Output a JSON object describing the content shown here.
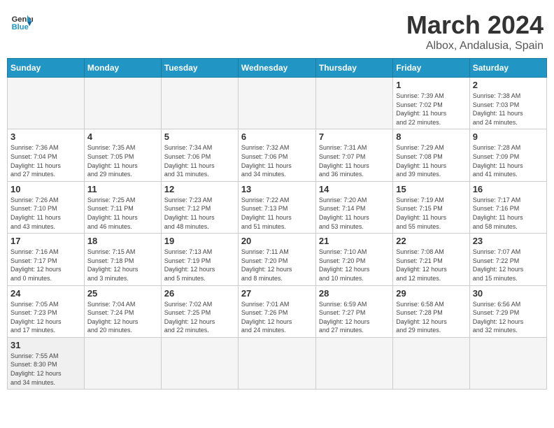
{
  "header": {
    "logo_text_black": "General",
    "logo_text_blue": "Blue",
    "main_title": "March 2024",
    "subtitle": "Albox, Andalusia, Spain"
  },
  "weekdays": [
    "Sunday",
    "Monday",
    "Tuesday",
    "Wednesday",
    "Thursday",
    "Friday",
    "Saturday"
  ],
  "weeks": [
    [
      {
        "day": "",
        "info": "",
        "empty": true
      },
      {
        "day": "",
        "info": "",
        "empty": true
      },
      {
        "day": "",
        "info": "",
        "empty": true
      },
      {
        "day": "",
        "info": "",
        "empty": true
      },
      {
        "day": "",
        "info": "",
        "empty": true
      },
      {
        "day": "1",
        "info": "Sunrise: 7:39 AM\nSunset: 7:02 PM\nDaylight: 11 hours\nand 22 minutes."
      },
      {
        "day": "2",
        "info": "Sunrise: 7:38 AM\nSunset: 7:03 PM\nDaylight: 11 hours\nand 24 minutes."
      }
    ],
    [
      {
        "day": "3",
        "info": "Sunrise: 7:36 AM\nSunset: 7:04 PM\nDaylight: 11 hours\nand 27 minutes."
      },
      {
        "day": "4",
        "info": "Sunrise: 7:35 AM\nSunset: 7:05 PM\nDaylight: 11 hours\nand 29 minutes."
      },
      {
        "day": "5",
        "info": "Sunrise: 7:34 AM\nSunset: 7:06 PM\nDaylight: 11 hours\nand 31 minutes."
      },
      {
        "day": "6",
        "info": "Sunrise: 7:32 AM\nSunset: 7:06 PM\nDaylight: 11 hours\nand 34 minutes."
      },
      {
        "day": "7",
        "info": "Sunrise: 7:31 AM\nSunset: 7:07 PM\nDaylight: 11 hours\nand 36 minutes."
      },
      {
        "day": "8",
        "info": "Sunrise: 7:29 AM\nSunset: 7:08 PM\nDaylight: 11 hours\nand 39 minutes."
      },
      {
        "day": "9",
        "info": "Sunrise: 7:28 AM\nSunset: 7:09 PM\nDaylight: 11 hours\nand 41 minutes."
      }
    ],
    [
      {
        "day": "10",
        "info": "Sunrise: 7:26 AM\nSunset: 7:10 PM\nDaylight: 11 hours\nand 43 minutes."
      },
      {
        "day": "11",
        "info": "Sunrise: 7:25 AM\nSunset: 7:11 PM\nDaylight: 11 hours\nand 46 minutes."
      },
      {
        "day": "12",
        "info": "Sunrise: 7:23 AM\nSunset: 7:12 PM\nDaylight: 11 hours\nand 48 minutes."
      },
      {
        "day": "13",
        "info": "Sunrise: 7:22 AM\nSunset: 7:13 PM\nDaylight: 11 hours\nand 51 minutes."
      },
      {
        "day": "14",
        "info": "Sunrise: 7:20 AM\nSunset: 7:14 PM\nDaylight: 11 hours\nand 53 minutes."
      },
      {
        "day": "15",
        "info": "Sunrise: 7:19 AM\nSunset: 7:15 PM\nDaylight: 11 hours\nand 55 minutes."
      },
      {
        "day": "16",
        "info": "Sunrise: 7:17 AM\nSunset: 7:16 PM\nDaylight: 11 hours\nand 58 minutes."
      }
    ],
    [
      {
        "day": "17",
        "info": "Sunrise: 7:16 AM\nSunset: 7:17 PM\nDaylight: 12 hours\nand 0 minutes."
      },
      {
        "day": "18",
        "info": "Sunrise: 7:15 AM\nSunset: 7:18 PM\nDaylight: 12 hours\nand 3 minutes."
      },
      {
        "day": "19",
        "info": "Sunrise: 7:13 AM\nSunset: 7:19 PM\nDaylight: 12 hours\nand 5 minutes."
      },
      {
        "day": "20",
        "info": "Sunrise: 7:11 AM\nSunset: 7:20 PM\nDaylight: 12 hours\nand 8 minutes."
      },
      {
        "day": "21",
        "info": "Sunrise: 7:10 AM\nSunset: 7:20 PM\nDaylight: 12 hours\nand 10 minutes."
      },
      {
        "day": "22",
        "info": "Sunrise: 7:08 AM\nSunset: 7:21 PM\nDaylight: 12 hours\nand 12 minutes."
      },
      {
        "day": "23",
        "info": "Sunrise: 7:07 AM\nSunset: 7:22 PM\nDaylight: 12 hours\nand 15 minutes."
      }
    ],
    [
      {
        "day": "24",
        "info": "Sunrise: 7:05 AM\nSunset: 7:23 PM\nDaylight: 12 hours\nand 17 minutes."
      },
      {
        "day": "25",
        "info": "Sunrise: 7:04 AM\nSunset: 7:24 PM\nDaylight: 12 hours\nand 20 minutes."
      },
      {
        "day": "26",
        "info": "Sunrise: 7:02 AM\nSunset: 7:25 PM\nDaylight: 12 hours\nand 22 minutes."
      },
      {
        "day": "27",
        "info": "Sunrise: 7:01 AM\nSunset: 7:26 PM\nDaylight: 12 hours\nand 24 minutes."
      },
      {
        "day": "28",
        "info": "Sunrise: 6:59 AM\nSunset: 7:27 PM\nDaylight: 12 hours\nand 27 minutes."
      },
      {
        "day": "29",
        "info": "Sunrise: 6:58 AM\nSunset: 7:28 PM\nDaylight: 12 hours\nand 29 minutes."
      },
      {
        "day": "30",
        "info": "Sunrise: 6:56 AM\nSunset: 7:29 PM\nDaylight: 12 hours\nand 32 minutes."
      }
    ],
    [
      {
        "day": "31",
        "info": "Sunrise: 7:55 AM\nSunset: 8:30 PM\nDaylight: 12 hours\nand 34 minutes."
      },
      {
        "day": "",
        "info": "",
        "empty": true
      },
      {
        "day": "",
        "info": "",
        "empty": true
      },
      {
        "day": "",
        "info": "",
        "empty": true
      },
      {
        "day": "",
        "info": "",
        "empty": true
      },
      {
        "day": "",
        "info": "",
        "empty": true
      },
      {
        "day": "",
        "info": "",
        "empty": true
      }
    ]
  ]
}
